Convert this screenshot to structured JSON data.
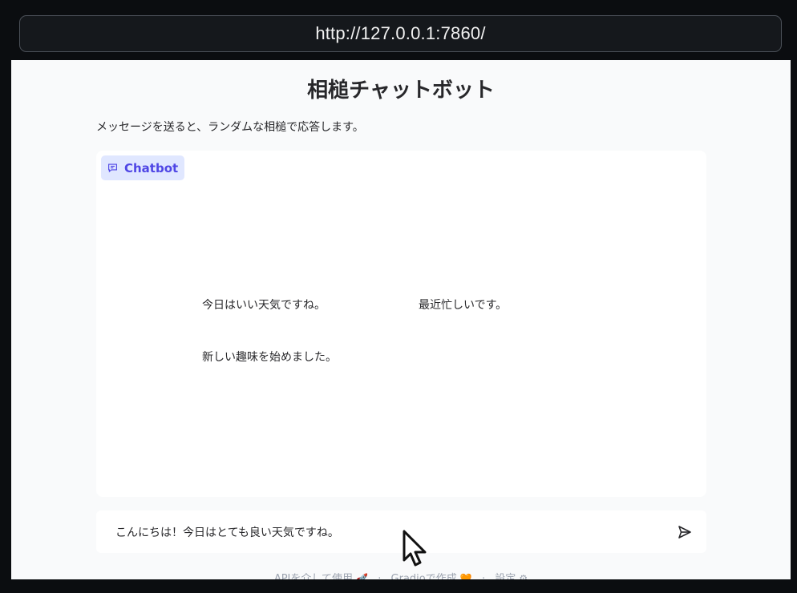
{
  "browser": {
    "url": "http://127.0.0.1:7860/"
  },
  "page": {
    "title": "相槌チャットボット",
    "description": "メッセージを送ると、ランダムな相槌で応答します。"
  },
  "chatbot": {
    "label": "Chatbot",
    "label_icon": "chat-bubble-icon",
    "examples": [
      "今日はいい天気ですね。",
      "最近忙しいです。",
      "新しい趣味を始めました。"
    ]
  },
  "input": {
    "value": "こんにちは！今日はとても良い天気ですね。",
    "send_icon": "send-icon"
  },
  "footer": {
    "api": "APIを介して使用",
    "api_emoji": "🚀",
    "gradio": "Gradioで作成",
    "gradio_emoji": "🧡",
    "settings": "設定",
    "settings_emoji": "⚙"
  },
  "colors": {
    "accent": "#4f46e5",
    "accent_bg": "#e0e7ff",
    "page_bg": "#f9fafb"
  }
}
